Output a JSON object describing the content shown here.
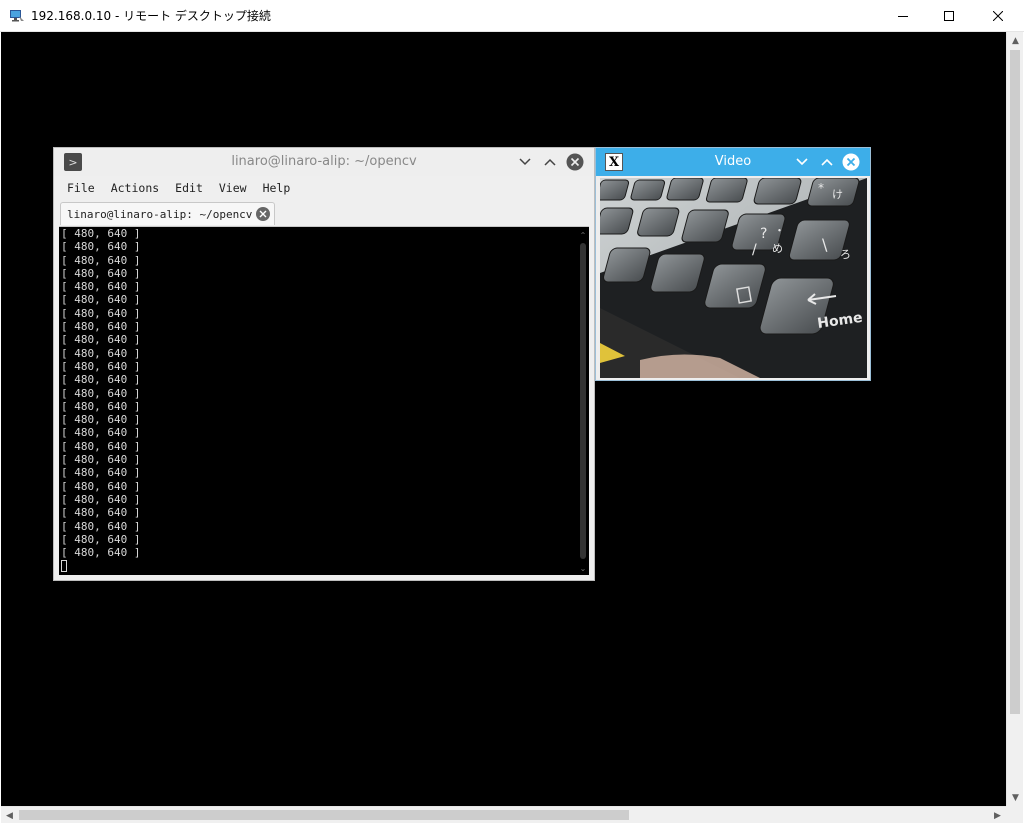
{
  "rdp": {
    "title": "192.168.0.10 - リモート デスクトップ接続"
  },
  "terminal": {
    "title": "linaro@linaro-alip: ~/opencv",
    "menu": [
      "File",
      "Actions",
      "Edit",
      "View",
      "Help"
    ],
    "tab_label": "linaro@linaro-alip: ~/opencv",
    "output_lines": [
      "[ 480, 640 ]",
      "[ 480, 640 ]",
      "[ 480, 640 ]",
      "[ 480, 640 ]",
      "[ 480, 640 ]",
      "[ 480, 640 ]",
      "[ 480, 640 ]",
      "[ 480, 640 ]",
      "[ 480, 640 ]",
      "[ 480, 640 ]",
      "[ 480, 640 ]",
      "[ 480, 640 ]",
      "[ 480, 640 ]",
      "[ 480, 640 ]",
      "[ 480, 640 ]",
      "[ 480, 640 ]",
      "[ 480, 640 ]",
      "[ 480, 640 ]",
      "[ 480, 640 ]",
      "[ 480, 640 ]",
      "[ 480, 640 ]",
      "[ 480, 640 ]",
      "[ 480, 640 ]",
      "[ 480, 640 ]",
      "[ 480, 640 ]"
    ]
  },
  "video": {
    "title": "Video",
    "keycaps": [
      "Home",
      "\\",
      "ろ",
      "?",
      "・",
      "/",
      "め",
      "け",
      "*"
    ]
  },
  "colors": {
    "kde_accent": "#3daee9",
    "terminal_bg": "#000000",
    "terminal_fg": "#d8d8d8"
  }
}
